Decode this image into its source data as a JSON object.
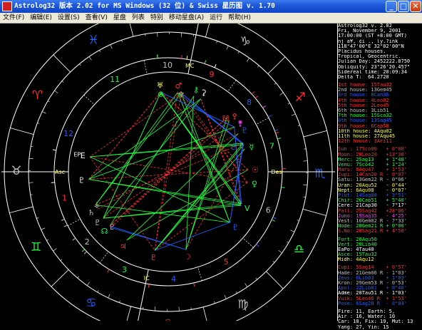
{
  "window": {
    "title": "Astrolog32 版本 2.02 for MS Windows (32 位) & Swiss 星历图 v. 1.70",
    "min_glyph": "_",
    "max_glyph": "□",
    "close_glyph": "✕"
  },
  "menu": [
    "文件(F)",
    "编辑(E)",
    "设置(S)",
    "查看(V)",
    "星盘",
    "列表",
    "特别",
    "移动星盘(A)",
    "运行",
    "帮助(H)"
  ],
  "info": [
    "Astrolog32 v. 2.02",
    "Fri, November 9, 2001",
    "17:00:00 (ST +8:00 GMT)",
    "nj a¥, ¢i ., ly.?ink",
    "118°47'00\"E 32°02'00\"N",
    "Placidus houses.",
    "Tropical, Geocentric.",
    "Julian Day: 2452222.8750",
    "Obliquity: 23°26'20.457\"",
    "Sidereal time: 20:09:34",
    "Delta T:  64.2720"
  ],
  "houses": [
    {
      "text": "1st house: 15Tau32",
      "color": "#ff3030"
    },
    {
      "text": "2nd house: 13Gem45",
      "color": "#c0c0c0"
    },
    {
      "text": "3rd house: 8Can36",
      "color": "#2060ff"
    },
    {
      "text": "4th house: 4Leo02",
      "color": "#ff3030"
    },
    {
      "text": "5th house: 2Leo45",
      "color": "#ff3030"
    },
    {
      "text": "6th house: 3Lib51",
      "color": "#c0c0c0"
    },
    {
      "text": "7th house: 15Sco32",
      "color": "#20ff40"
    },
    {
      "text": "8th house: 13Sag45",
      "color": "#2060ff"
    },
    {
      "text": "9th house: 6Cap58",
      "color": "#ff3030"
    },
    {
      "text": "10th house: 4Aqu02",
      "color": "#ffff40"
    },
    {
      "text": "11th house: 27Aqu45",
      "color": "#ffff40"
    },
    {
      "text": "12th house: 3Ari11",
      "color": "#ff3030"
    }
  ],
  "planets": [
    {
      "text": "Sun : 17Sco00   + 0°00'",
      "color": "#ff3030"
    },
    {
      "text": "Moon: 28Leo20   +13°30'",
      "color": "#ff3030"
    },
    {
      "text": "Merc: 2Sag13    + 1°48'",
      "color": "#20ff40"
    },
    {
      "text": "Venu: 7Sco42    + 1°24'",
      "color": "#20ff40"
    },
    {
      "text": "Mars: 8Aqu47    + 1°53'",
      "color": "#ff3030"
    },
    {
      "text": "Jupi: 14Can20 R - 0°07'",
      "color": "#ff3030"
    },
    {
      "text": "Satu: 13Gem22 R - 0°06'",
      "color": "#c0c0c0"
    },
    {
      "text": "Uran: 20Aqu52   - 0°44'",
      "color": "#ffff40"
    },
    {
      "text": "Nept: 6Aqu08    - 0°07'",
      "color": "#ffff40"
    },
    {
      "text": "Plut: 14Sag08   + 3°51'",
      "color": "#2060ff"
    },
    {
      "text": "Chir: 26Cap51   + 5°40'",
      "color": "#20ff40"
    },
    {
      "text": "Cere: 21Cap30   - 7°17'",
      "color": "#ffffff"
    },
    {
      "text": "Pall: 25Sag42   +28°06'",
      "color": "#ff3030"
    },
    {
      "text": "Juno: 19Sag35   - 4°25'",
      "color": "#ff40ff"
    },
    {
      "text": "Vest: 10Gem02 R - 7°33'",
      "color": "#c0c0c0"
    },
    {
      "text": "Node: 28Gem21 R + 0°00'",
      "color": "#20ff40"
    },
    {
      "text": "S.No: 28Sag21 R + 4°50'",
      "color": "#ff3030"
    }
  ],
  "points": [
    {
      "text": "Fort: 20Aqu50",
      "color": "#20ff40"
    },
    {
      "text": "Vert: 20Lib40",
      "color": "#20ff40"
    },
    {
      "text": "EaPo: 4Tau40",
      "color": "#ffffff"
    },
    {
      "text": "Asce: 15Tau32",
      "color": "#20ff40"
    },
    {
      "text": "Midh: 4Aqu12",
      "color": "#ffff40"
    }
  ],
  "uranians": [
    {
      "text": "Cupi: 5Sag14    + 0°57'",
      "color": "#ff3030"
    },
    {
      "text": "Hade: 21Gem06 R - 1°03'",
      "color": "#c0c0c0"
    },
    {
      "text": "Zeus: 6Lib03    + 1°03'",
      "color": "#2060ff"
    },
    {
      "text": "Kron: 29Gem53 R - 0°53'",
      "color": "#c0c0c0"
    },
    {
      "text": "Apol: 22Lib01   + 0°40'",
      "color": "#2060ff"
    },
    {
      "text": "Adme: 20Tau51 R - 1°03'",
      "color": "#ffffff"
    },
    {
      "text": "Vulk: 5Leo46 R  + 1°53'",
      "color": "#ff3030"
    },
    {
      "text": "Pose: 6Sag28 R  - 0°04'",
      "color": "#2060ff"
    }
  ],
  "summary": [
    "Fire: 11, Earth: 5,",
    "Air : 16, Water: 10",
    "Car: 10, Fix: 19, Mut: 13",
    "Yang: 27, Yin: 15"
  ],
  "colors": {
    "fire": "#ff3030",
    "earth": "#c0c0c0",
    "air": "#20ff40",
    "water": "#2060ff",
    "accent": "#ffff40",
    "magenta": "#ff40ff",
    "white": "#ffffff"
  },
  "wheel": {
    "sign_glyphs": [
      "♈",
      "♉",
      "♊",
      "♋",
      "♌",
      "♍",
      "♎",
      "♏",
      "♐",
      "♑",
      "♒",
      "♓"
    ],
    "house_numbers": [
      "1",
      "2",
      "3",
      "4",
      "5",
      "6",
      "7",
      "8",
      "9",
      "10",
      "11",
      "12"
    ],
    "labels": {
      "asc": "Asc",
      "dsc": "Des",
      "mc": "MC",
      "ic": "IC",
      "ep": "EP"
    }
  }
}
